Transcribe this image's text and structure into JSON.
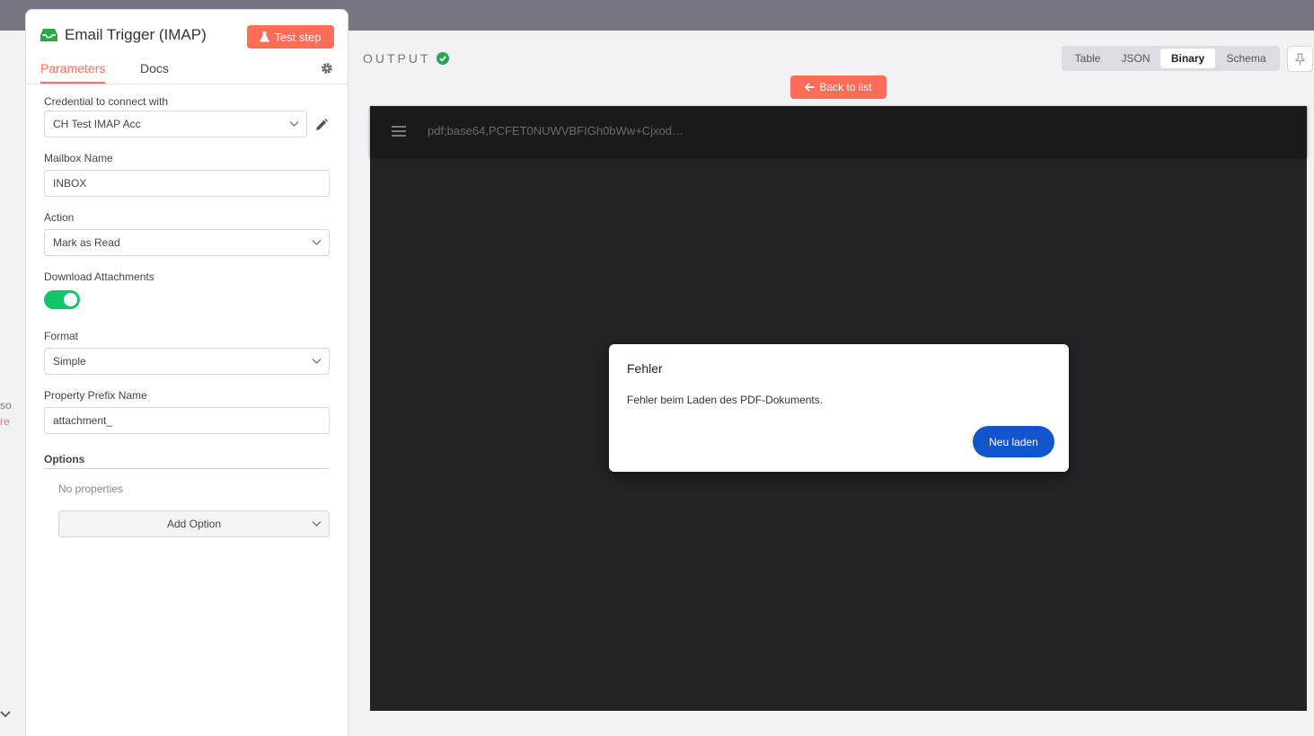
{
  "panel": {
    "title": "Email Trigger (IMAP)",
    "test_step_label": "Test step",
    "tabs": [
      {
        "label": "Parameters",
        "active": true
      },
      {
        "label": "Docs",
        "active": false
      }
    ],
    "fields": {
      "credential": {
        "label": "Credential to connect with",
        "value": "CH Test IMAP Acc"
      },
      "mailbox": {
        "label": "Mailbox Name",
        "value": "INBOX"
      },
      "action": {
        "label": "Action",
        "value": "Mark as Read"
      },
      "download_attachments": {
        "label": "Download Attachments",
        "enabled": true
      },
      "format": {
        "label": "Format",
        "value": "Simple"
      },
      "prefix": {
        "label": "Property Prefix Name",
        "value": "attachment_"
      }
    },
    "options": {
      "label": "Options",
      "empty_text": "No properties",
      "add_label": "Add Option"
    }
  },
  "left_strip": {
    "text1": "so",
    "text2": "re"
  },
  "output": {
    "title": "OUTPUT",
    "view_modes": [
      {
        "label": "Table",
        "active": false
      },
      {
        "label": "JSON",
        "active": false
      },
      {
        "label": "Binary",
        "active": true
      },
      {
        "label": "Schema",
        "active": false
      }
    ],
    "back_label": "Back to list"
  },
  "viewer": {
    "file_title": "pdf;base64,PCFET0NUWVBFIGh0bWw+Cjxod…",
    "dialog": {
      "title": "Fehler",
      "message": "Fehler beim Laden des PDF-Dokuments.",
      "button_label": "Neu laden"
    }
  },
  "colors": {
    "accent": "#ff6d5a",
    "success": "#13c369",
    "viewer_bg": "#232325",
    "dialog_button": "#1055cc"
  }
}
